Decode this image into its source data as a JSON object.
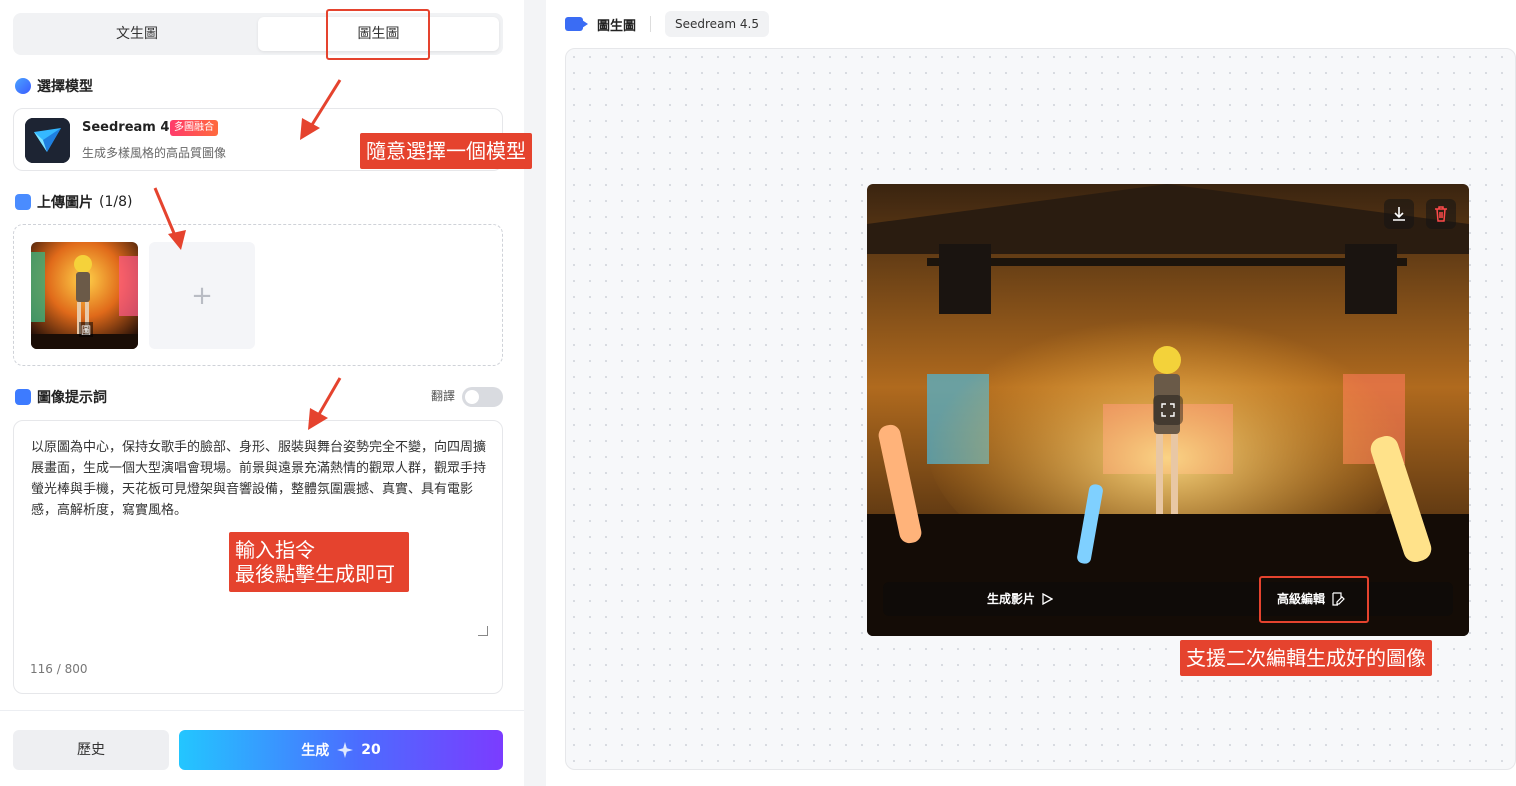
{
  "tabs": {
    "text_to_image": "文生圖",
    "image_to_image": "圖生圖"
  },
  "model_section": {
    "title": "選擇模型",
    "model_name": "Seedream 4.5",
    "badge": "多圖融合",
    "description": "生成多樣風格的高品質圖像"
  },
  "upload_section": {
    "title": "上傳圖片",
    "count": "(1/8)",
    "thumb_label": "圖",
    "add_symbol": "+"
  },
  "prompt_section": {
    "title": "圖像提示詞",
    "translate_label": "翻譯",
    "text": "以原圖為中心，保持女歌手的臉部、身形、服裝與舞台姿勢完全不變，向四周擴展畫面，生成一個大型演唱會現場。前景與遠景充滿熱情的觀眾人群，觀眾手持螢光棒與手機，天花板可見燈架與音響設備，整體氛圍震撼、真實、具有電影感，高解析度，寫實風格。",
    "counter": "116 / 800"
  },
  "actions": {
    "history": "歷史",
    "generate": "生成",
    "cost": "20"
  },
  "right_header": {
    "title": "圖生圖",
    "model_chip": "Seedream 4.5"
  },
  "result": {
    "make_video": "生成影片",
    "advanced_edit": "高級編輯"
  },
  "annotations": {
    "choose_model": "隨意選擇一個模型",
    "input_line1": "輸入指令",
    "input_line2": "最後點擊生成即可",
    "edit_support": "支援二次編輯生成好的圖像"
  },
  "colors": {
    "accent_red": "#e5432e",
    "generate_gradient_start": "#23c6ff",
    "generate_gradient_end": "#7b3cff"
  }
}
